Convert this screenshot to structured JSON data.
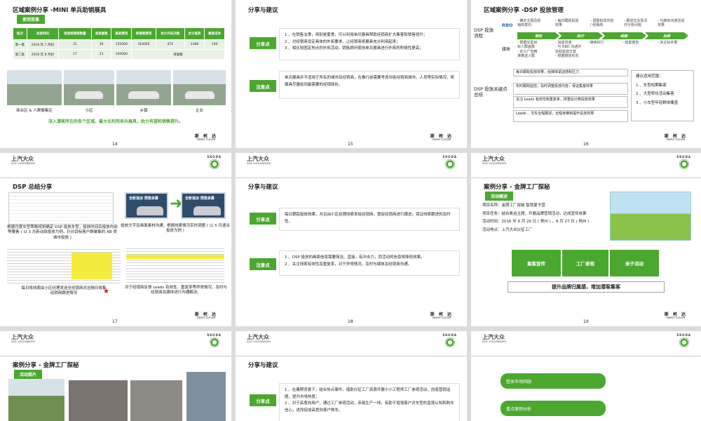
{
  "slides": [
    {
      "page": "14",
      "title": "区域案例分享 -MINI 单兵助销展具",
      "tag": "使用效果",
      "columns": [
        "批次",
        "发放时间",
        "发放经销商数量",
        "发放套数",
        "展具费用",
        "经销商费用",
        "合计外拓次数",
        "合计留资",
        "集客成本"
      ],
      "rows": [
        [
          "第一批",
          "2016 年 7 月初",
          "31",
          "36",
          "155000",
          "310000",
          "476",
          "2389",
          "194"
        ],
        [
          "第二批",
          "2016 年 8 月初",
          "17",
          "23",
          "100000",
          "待收集"
        ]
      ],
      "photos": [
        "商业区 & 人群聚集区",
        "小区",
        "乡镇",
        "企业"
      ],
      "note": "深入潜客所在的各个区域，最大化利用单兵展具，助力有望和销售提升。"
    },
    {
      "page": "15",
      "title": "分享与建议",
      "blocks": [
        {
          "label": "分享点",
          "lines": [
            "1 、在销售淡季，特别是夏季，可以利用单兵展具帮助经销商扩大集客和销售提升；",
            "2 、对经销商设定具体的外拓要求，让经销商将展具充分利用起来；",
            "3 、相比较固定地点的外拓活动，销售顾问使用单兵展具进行外拓的积极性更高；"
          ]
        },
        {
          "label": "注意点",
          "lines": [
            "单兵展具并不适用于所有的城市及经销商，在推行前需要考虑到各经销商城市、人员等实际情况，将展具尽量给到最需要的经销商处。"
          ]
        }
      ]
    },
    {
      "page": "16",
      "title": "区域案例分享 -DSP 投放管理",
      "flow_label": "DSP 投放流程",
      "rbo": "RBO",
      "media": "媒体",
      "stages": [
        "策划",
        "执行",
        "结案",
        "后续"
      ],
      "top": [
        [
          "- 确定主题及经销商意向"
        ],
        [
          "- 每日跟踪投放效果"
        ],
        [
          "- 调整投放内容 / 经销商"
        ],
        [
          "- 跟进交车情况并分析问题"
        ],
        [
          "- 与媒体沟通活动效果"
        ]
      ],
      "bottom": [
        [
          "- 根据车型目标人群画像",
          "- 定义广告精准推送人群"
        ],
        [
          "- 加强沟通",
          "- 与 RBO 沟通并协助投放方案",
          "- 根据媒体形态"
        ],
        [
          "- 继续执行"
        ],
        [
          "- 结案报告"
        ],
        [
          "- 未达标补量"
        ]
      ],
      "key_label": "DSP 投放关键点总结",
      "points": [
        "每日跟踪投放效果，给媒体紧迫感和压力",
        "实时跟踪监控，及时调整投放内容，保证集客效果",
        "关注 Leads 有效性和重复率，排重后计算投放效果",
        "Leads 、交车全程跟进，全程考察和提升投放效果"
      ],
      "advice_title": "建议适用范围：",
      "advice": [
        "1 、车型短期集客",
        "2 、大型转化活动集客",
        "3 、小车型年轻群体覆盖"
      ]
    },
    {
      "page": "17",
      "title": "DSP 总结分享",
      "ad_text": "全新速派 预售启幕",
      "captions": [
        "根据月度车型策略规划确定 DSP 投放车型，投放时间及投放内容等要素 ( 以 3 月新动政投放为例，针对目标客户群聚集的 AB 类城市投放 )",
        "投放文字及画面素材沟通，根据线索情况实时调整 ( 以 5 月速派投放为例 )",
        "每日将线索由小区经理发送至经销商并且隔日收集经销商跟进情况",
        "对于经销商反馈 Leads 有效性、重复率等异常情况，及时与经销商及媒体进行沟通解决。"
      ]
    },
    {
      "page": "18",
      "title": "分享与建议",
      "blocks": [
        {
          "label": "分享点",
          "lines": [
            "每日跟踪投放效果，并且由小区经理线索发给经销商，督促经销商进行跟进，保证线索跟进的及时性。"
          ]
        },
        {
          "label": "注意点",
          "lines": [
            "1 、DSP 投放的画面信息需要简洁、直接，有冲击力，而活动的信息将降低效果。",
            "2 、关注线索有效性及重复率，对于异常情况，及时与媒体及经销商沟通。"
          ]
        }
      ]
    },
    {
      "page": "19",
      "title": "案例分享 - 金牌工厂探秘",
      "tag": "活动概述",
      "items": [
        "项目名称：金牌工厂探秘 智慧夏令营",
        "项目任务：结合奥运主题，开展品牌营销活动，达成宣传效果",
        "活动时间：2016 年 8 月 26 日 ( 常州 ) 、8 月 27 日 ( 扬州 )",
        "活动地点：上汽大众仪征工厂"
      ],
      "boxes": [
        "集客宣传",
        "工厂参观",
        "亲子活动"
      ],
      "banner": "提升品牌归属感，增加潜客集客"
    },
    {
      "title": "案例分享 - 金牌工厂探秘",
      "tag": "活动照片"
    },
    {
      "title": "分享与建议",
      "label": "分享点",
      "lines": [
        "1 、在暑期背景下，结合热点事件，借助仪征工厂资源开展小小工程师工厂参观活动，创造营销话题，提升市场热度；",
        "2 、对于高意向用户，通过工厂参观活动，亲临生产一线，有助于增强客户对车型的直观认知和购车信心，进而促成高意向客户购车。"
      ]
    },
    {
      "items": [
        "整体市场回顾",
        "重点案例分析"
      ]
    }
  ],
  "brand": {
    "cn": "上汽大众",
    "en": "SAIC VOLKSWAGEN"
  },
  "skoda": {
    "word": "ŠKODA"
  },
  "footer": {
    "cn": "斯 柯 达",
    "en": "SIMPLY CLEVER"
  },
  "colors": {
    "green": "#4ba82e"
  }
}
